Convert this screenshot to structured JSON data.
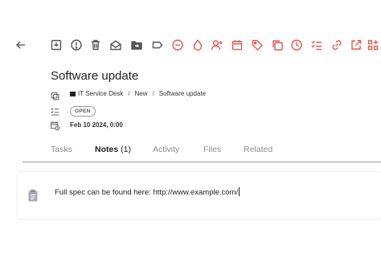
{
  "toolbar": {
    "icons": [
      {
        "name": "back-arrow-icon",
        "color": "#6b6b6b"
      },
      {
        "name": "archive-box-icon",
        "color": "#555555"
      },
      {
        "name": "alert-circle-icon",
        "color": "#555555"
      },
      {
        "name": "trash-icon",
        "color": "#555555"
      },
      {
        "name": "mail-open-icon",
        "color": "#555555"
      },
      {
        "name": "folder-move-icon",
        "color": "#555555"
      },
      {
        "name": "label-icon",
        "color": "#555555"
      },
      {
        "name": "do-not-disturb-icon",
        "color": "#e8574f"
      },
      {
        "name": "drop-icon",
        "color": "#e8574f"
      },
      {
        "name": "person-add-icon",
        "color": "#e8574f"
      },
      {
        "name": "calendar-icon",
        "color": "#e8574f"
      },
      {
        "name": "tag-icon",
        "color": "#e8574f"
      },
      {
        "name": "copy-icon",
        "color": "#e8574f"
      },
      {
        "name": "clock-icon",
        "color": "#e8574f"
      },
      {
        "name": "checklist-icon",
        "color": "#e8574f"
      },
      {
        "name": "link-icon",
        "color": "#e8574f"
      },
      {
        "name": "open-external-icon",
        "color": "#e8574f"
      },
      {
        "name": "apps-add-icon",
        "color": "#e8574f"
      }
    ]
  },
  "ticket": {
    "title": "Software update",
    "breadcrumb": {
      "workspace": "IT Service Desk",
      "separator": "/",
      "stage": "New",
      "item": "Software update"
    },
    "status": "OPEN",
    "date": "Feb 10 2024, 0:00"
  },
  "tabs": [
    {
      "label": "Tasks",
      "count": ""
    },
    {
      "label": "Notes",
      "count": "(1)"
    },
    {
      "label": "Activity",
      "count": ""
    },
    {
      "label": "Files",
      "count": ""
    },
    {
      "label": "Related",
      "count": ""
    }
  ],
  "note": {
    "text": "Full spec can be found here: http://www.example.com/"
  },
  "colors": {
    "accent": "#e8574f",
    "icon_gray": "#555555"
  }
}
